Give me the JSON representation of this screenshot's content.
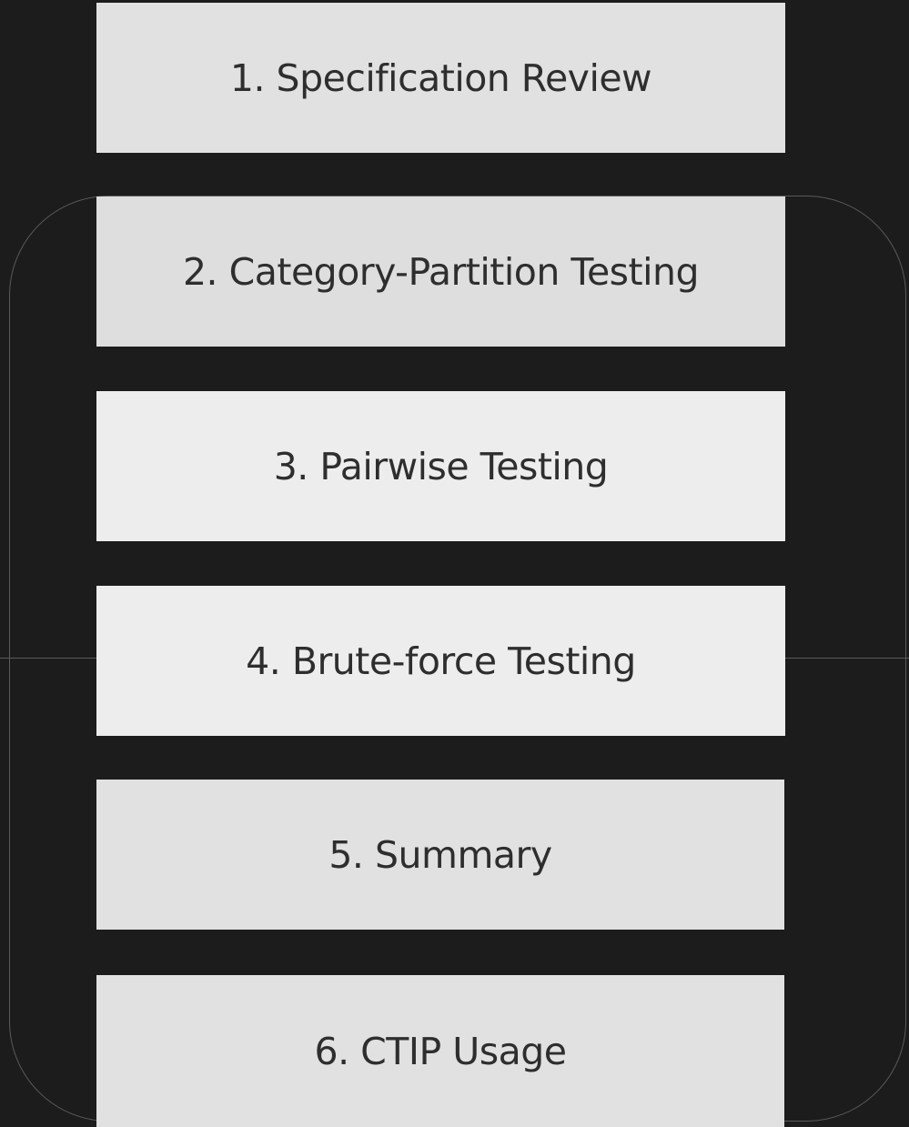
{
  "steps": [
    {
      "label": "1. Specification Review"
    },
    {
      "label": "2. Category-Partition Testing"
    },
    {
      "label": "3. Pairwise Testing"
    },
    {
      "label": "4. Brute-force Testing"
    },
    {
      "label": "5. Summary"
    },
    {
      "label": "6. CTIP Usage"
    }
  ],
  "colors": {
    "background": "#1c1c1c",
    "box_light": "#ededed",
    "box_mid": "#e1e1e1",
    "text": "#2e2e2e",
    "frame_line": "#5a5a5a"
  }
}
